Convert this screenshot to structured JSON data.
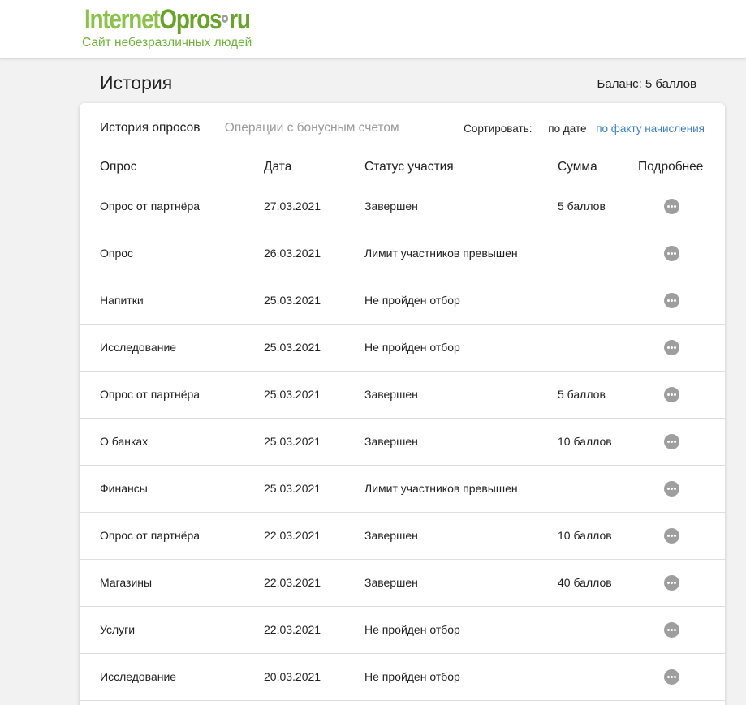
{
  "header": {
    "logo_part1": "Internet",
    "logo_part2": "Opros",
    "logo_part3": "ru",
    "tagline": "Сайт небезразличных людей"
  },
  "page": {
    "title": "История",
    "balance": "Баланс: 5 баллов"
  },
  "tabs": [
    {
      "label": "История опросов",
      "active": true
    },
    {
      "label": "Операции с бонусным счетом",
      "active": false
    }
  ],
  "sort": {
    "label": "Сортировать:",
    "options": [
      {
        "label": "по дате",
        "active": true
      },
      {
        "label": "по факту начисления",
        "active": false
      }
    ]
  },
  "table": {
    "columns": [
      "Опрос",
      "Дата",
      "Статус участия",
      "Сумма",
      "Подробнее"
    ],
    "rows": [
      {
        "survey": "Опрос от партнёра",
        "date": "27.03.2021",
        "status": "Завершен",
        "sum": "5 баллов"
      },
      {
        "survey": "Опрос",
        "date": "26.03.2021",
        "status": "Лимит участников превышен",
        "sum": ""
      },
      {
        "survey": "Напитки",
        "date": "25.03.2021",
        "status": "Не пройден отбор",
        "sum": ""
      },
      {
        "survey": "Исследование",
        "date": "25.03.2021",
        "status": "Не пройден отбор",
        "sum": ""
      },
      {
        "survey": "Опрос от партнёра",
        "date": "25.03.2021",
        "status": "Завершен",
        "sum": "5 баллов"
      },
      {
        "survey": "О банках",
        "date": "25.03.2021",
        "status": "Завершен",
        "sum": "10 баллов"
      },
      {
        "survey": "Финансы",
        "date": "25.03.2021",
        "status": "Лимит участников превышен",
        "sum": ""
      },
      {
        "survey": "Опрос от партнёра",
        "date": "22.03.2021",
        "status": "Завершен",
        "sum": "10 баллов"
      },
      {
        "survey": "Магазины",
        "date": "22.03.2021",
        "status": "Завершен",
        "sum": "40 баллов"
      },
      {
        "survey": "Услуги",
        "date": "22.03.2021",
        "status": "Не пройден отбор",
        "sum": ""
      },
      {
        "survey": "Исследование",
        "date": "20.03.2021",
        "status": "Не пройден отбор",
        "sum": ""
      }
    ]
  },
  "icons": {
    "more": "more-dots-icon",
    "logo_dot": "dot-icon"
  },
  "colors": {
    "brand_green": "#8bc34a",
    "tagline_green": "#6fb33a",
    "link_blue": "#3a7fc1",
    "icon_gray": "#9e9e9e"
  }
}
